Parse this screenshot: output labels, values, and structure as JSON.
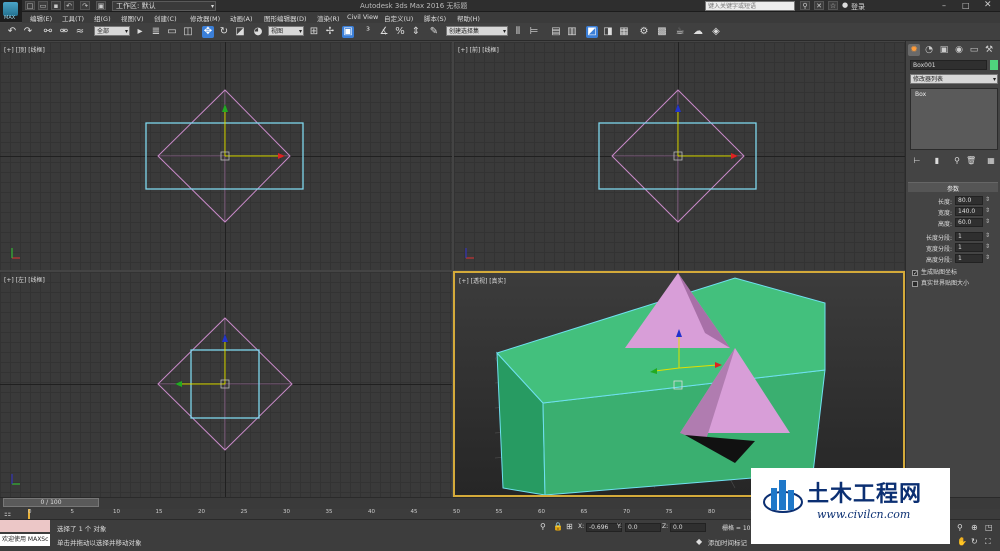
{
  "titlebar": {
    "logo_text": "MAX",
    "workspace": "工作区: 默认",
    "app_title": "Autodesk 3ds Max 2016    无标题",
    "search_placeholder": "键入关键字或短语",
    "login": "登录"
  },
  "menubar": {
    "items": [
      "编辑(E)",
      "工具(T)",
      "组(G)",
      "视图(V)",
      "创建(C)",
      "修改器(M)",
      "动画(A)",
      "图形编辑器(D)",
      "渲染(R)",
      "Civil View",
      "自定义(U)",
      "脚本(S)",
      "帮助(H)"
    ]
  },
  "toolbar": {
    "selection_filter": "全部",
    "ref_coord": "视图",
    "named_selection": "创建选择集"
  },
  "viewports": {
    "top": "[+] [顶] [线框]",
    "front": "[+] [前] [线框]",
    "left": "[+] [左] [线框]",
    "perspective": "[+] [透视] [真实]"
  },
  "command_panel": {
    "object_name": "Box001",
    "object_color": "#4fd37d",
    "modifier_list": "修改器列表",
    "stack_item": "Box",
    "rollout_title": "参数",
    "params": [
      {
        "label": "长度:",
        "value": "80.0"
      },
      {
        "label": "宽度:",
        "value": "140.0"
      },
      {
        "label": "高度:",
        "value": "60.0"
      },
      {
        "label": "长度分段:",
        "value": "1"
      },
      {
        "label": "宽度分段:",
        "value": "1"
      },
      {
        "label": "高度分段:",
        "value": "1"
      }
    ],
    "checks": [
      {
        "label": "生成贴图坐标",
        "checked": true
      },
      {
        "label": "真实世界贴图大小",
        "checked": false
      }
    ]
  },
  "timeline": {
    "frame": "0 / 100",
    "ticks": [
      "0",
      "5",
      "10",
      "15",
      "20",
      "25",
      "30",
      "35",
      "40",
      "45",
      "50",
      "55",
      "60",
      "65",
      "70",
      "75",
      "80",
      "85",
      "90"
    ]
  },
  "status": {
    "welcome": "欢迎使用 MAXSc",
    "line1": "选择了 1 个 对象",
    "line2": "单击并拖动以选择并移动对象",
    "x_label": "X:",
    "x_value": "-0.696",
    "y_label": "Y:",
    "y_value": "0.0",
    "z_label": "Z:",
    "z_value": "0.0",
    "grid": "栅格 = 10.0",
    "add_time_tag": "添加时间标记"
  },
  "watermark": {
    "title": "土木工程网",
    "url": "www.civilcn.com"
  }
}
